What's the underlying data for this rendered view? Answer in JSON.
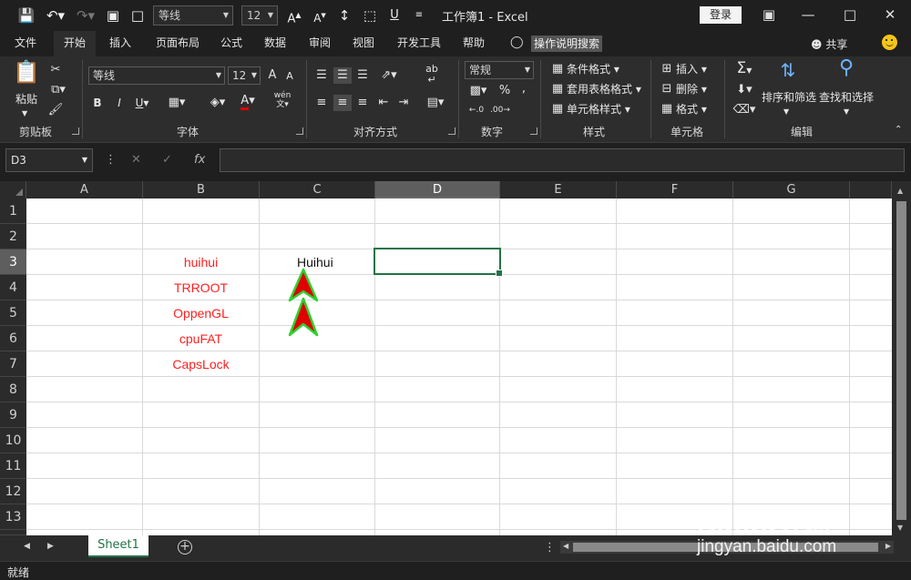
{
  "titlebar": {
    "font_name": "等线",
    "font_size": "12",
    "title": "工作簿1  -  Excel",
    "login": "登录"
  },
  "tabs": [
    "文件",
    "开始",
    "插入",
    "页面布局",
    "公式",
    "数据",
    "审阅",
    "视图",
    "开发工具",
    "帮助"
  ],
  "active_tab": "开始",
  "tell_me": "操作说明搜索",
  "share": "共享",
  "ribbon": {
    "clipboard": {
      "paste": "粘贴",
      "label": "剪贴板"
    },
    "font": {
      "name": "等线",
      "size": "12",
      "bold": "B",
      "italic": "I",
      "underline": "U",
      "label": "字体",
      "grow": "A",
      "shrink": "A",
      "wen": "wén"
    },
    "alignment": {
      "label": "对齐方式",
      "ab": "ab"
    },
    "number": {
      "format": "常规",
      "percent": "%",
      "comma": ",",
      "label": "数字"
    },
    "styles": {
      "conditional": "条件格式",
      "table": "套用表格格式",
      "cell": "单元格样式",
      "label": "样式"
    },
    "cells": {
      "insert": "插入",
      "delete": "删除",
      "format": "格式",
      "label": "单元格"
    },
    "editing": {
      "sort": "排序和筛选",
      "find": "查找和选择",
      "label": "编辑"
    }
  },
  "formula_bar": {
    "name_box": "D3",
    "fx": "fx",
    "value": ""
  },
  "grid": {
    "columns": [
      "A",
      "B",
      "C",
      "D",
      "E",
      "F",
      "G"
    ],
    "rows": [
      "1",
      "2",
      "3",
      "4",
      "5",
      "6",
      "7",
      "8",
      "9",
      "10",
      "11",
      "12",
      "13"
    ],
    "selected_cell": "D3",
    "cells": {
      "B3": "huihui",
      "B4": "TRROOT",
      "B5": "OppenGL",
      "B6": "cpuFAT",
      "B7": "CapsLock",
      "C3": "Huihui"
    }
  },
  "sheet_tabs": [
    "Sheet1"
  ],
  "status": "就绪",
  "watermark": {
    "brand": "Baidu经验",
    "url": "jingyan.baidu.com"
  },
  "colors": {
    "cell_text_red": "#ff2020",
    "arrow_fill": "#e00000",
    "arrow_outline": "#2fd02f",
    "selection_green": "#217346"
  }
}
